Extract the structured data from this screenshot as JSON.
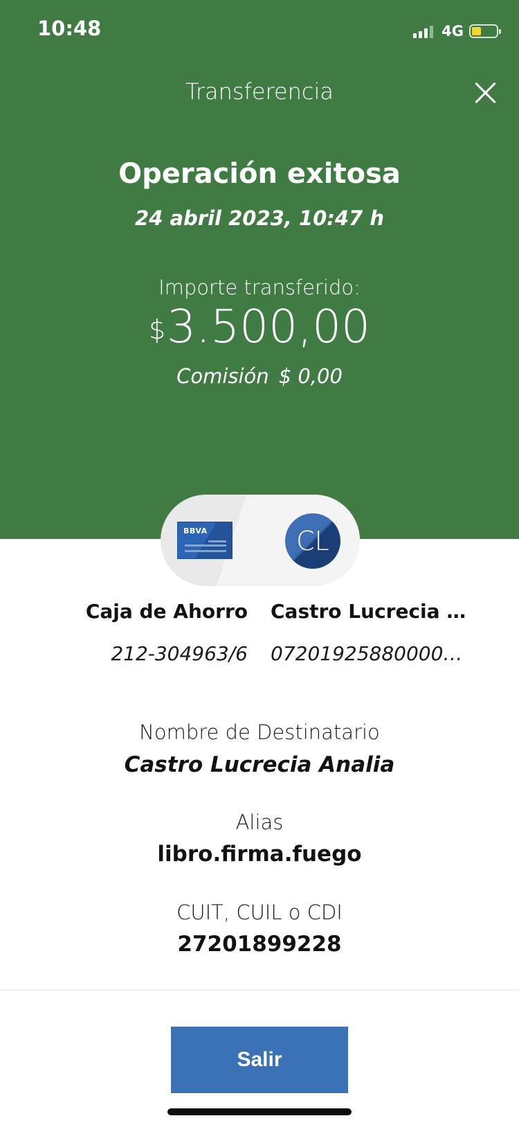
{
  "status_bar": {
    "time": "10:48",
    "network": "4G"
  },
  "header": {
    "title": "Transferencia"
  },
  "operation": {
    "title": "Operación exitosa",
    "date": "24 abril 2023, 10:47 h",
    "amount_label": "Importe transferido:",
    "currency_symbol": "$",
    "amount": "3.500,00",
    "commission_label": "Comisión",
    "commission_value": "$ 0,00"
  },
  "origin": {
    "bank_logo": "BBVA",
    "account_name": "Caja de Ahorro",
    "account_number": "212-304963/6"
  },
  "destination": {
    "avatar_initials": "CL",
    "name": "Castro Lucrecia A...",
    "account_number": "072019258800003..."
  },
  "details": [
    {
      "label": "Nombre de Destinatario",
      "value": "Castro Lucrecia Analia"
    },
    {
      "label": "Alias",
      "value": "libro.firma.fuego"
    },
    {
      "label": "CUIT, CUIL o CDI",
      "value": "27201899228"
    }
  ],
  "footer": {
    "exit_label": "Salir"
  },
  "colors": {
    "header_green": "#417b44",
    "button_blue": "#3a72b5",
    "card_blue": "#2b65b3"
  },
  "icons": {
    "close": "close-icon",
    "signal": "signal-icon",
    "battery": "battery-icon"
  }
}
